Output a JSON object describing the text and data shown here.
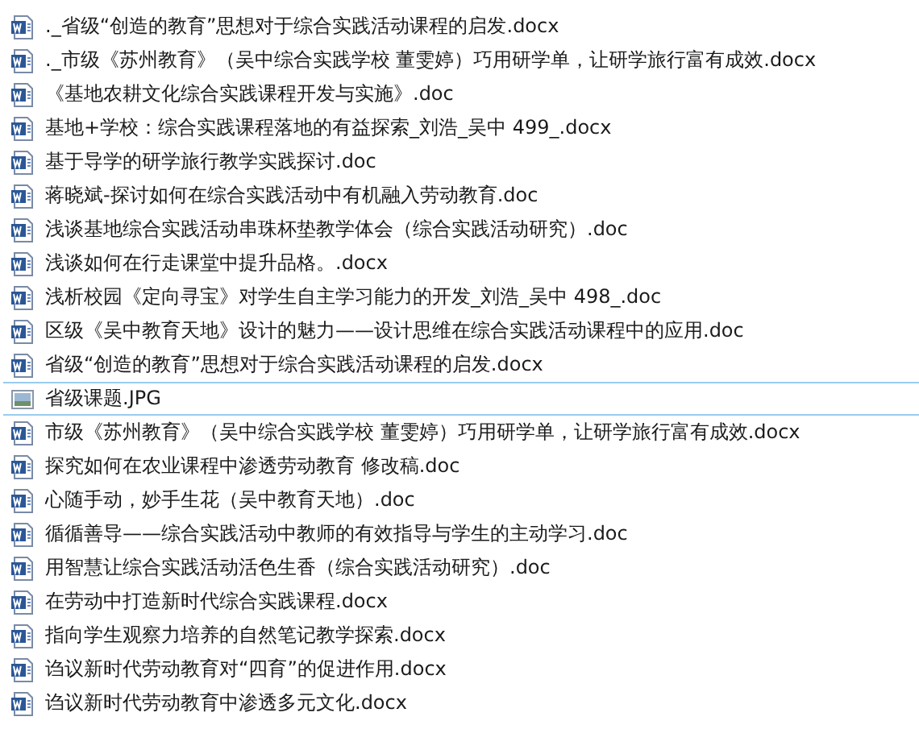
{
  "files": [
    {
      "name": "._省级“创造的教育”思想对于综合实践活动课程的启发.docx",
      "kind": "word",
      "selected": false
    },
    {
      "name": "._市级《苏州教育》（吴中综合实践学校 董雯婷）巧用研学单，让研学旅行富有成效.docx",
      "kind": "word",
      "selected": false
    },
    {
      "name": "《基地农耕文化综合实践课程开发与实施》.doc",
      "kind": "word",
      "selected": false
    },
    {
      "name": "基地+学校：综合实践课程落地的有益探索_刘浩_吴中 499_.docx",
      "kind": "word",
      "selected": false
    },
    {
      "name": "基于导学的研学旅行教学实践探讨.doc",
      "kind": "word",
      "selected": false
    },
    {
      "name": "蒋晓斌-探讨如何在综合实践活动中有机融入劳动教育.doc",
      "kind": "word",
      "selected": false
    },
    {
      "name": "浅谈基地综合实践活动串珠杯垫教学体会（综合实践活动研究）.doc",
      "kind": "word",
      "selected": false
    },
    {
      "name": "浅谈如何在行走课堂中提升品格。.docx",
      "kind": "word",
      "selected": false
    },
    {
      "name": "浅析校园《定向寻宝》对学生自主学习能力的开发_刘浩_吴中 498_.doc",
      "kind": "word",
      "selected": false
    },
    {
      "name": "区级《吴中教育天地》设计的魅力——设计思维在综合实践活动课程中的应用.doc",
      "kind": "word",
      "selected": false
    },
    {
      "name": "省级“创造的教育”思想对于综合实践活动课程的启发.docx",
      "kind": "word",
      "selected": false
    },
    {
      "name": "省级课题.JPG",
      "kind": "image",
      "selected": true
    },
    {
      "name": "市级《苏州教育》（吴中综合实践学校 董雯婷）巧用研学单，让研学旅行富有成效.docx",
      "kind": "word",
      "selected": false
    },
    {
      "name": "探究如何在农业课程中渗透劳动教育 修改稿.doc",
      "kind": "word",
      "selected": false
    },
    {
      "name": "心随手动，妙手生花（吴中教育天地）.doc",
      "kind": "word",
      "selected": false
    },
    {
      "name": "循循善导——综合实践活动中教师的有效指导与学生的主动学习.doc",
      "kind": "word",
      "selected": false
    },
    {
      "name": "用智慧让综合实践活动活色生香（综合实践活动研究）.doc",
      "kind": "word",
      "selected": false
    },
    {
      "name": "在劳动中打造新时代综合实践课程.docx",
      "kind": "word",
      "selected": false
    },
    {
      "name": "指向学生观察力培养的自然笔记教学探索.docx",
      "kind": "word",
      "selected": false
    },
    {
      "name": "诌议新时代劳动教育对“四育”的促进作用.docx",
      "kind": "word",
      "selected": false
    },
    {
      "name": "诌议新时代劳动教育中渗透多元文化.docx",
      "kind": "word",
      "selected": false
    }
  ]
}
